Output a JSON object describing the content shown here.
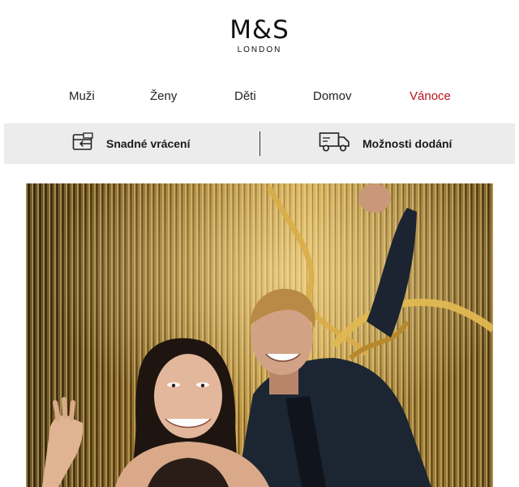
{
  "brand": {
    "name": "M&S",
    "subtitle": "LONDON"
  },
  "nav": {
    "items": [
      {
        "label": "Muži"
      },
      {
        "label": "Ženy"
      },
      {
        "label": "Děti"
      },
      {
        "label": "Domov"
      },
      {
        "label": "Vánoce"
      }
    ],
    "accent_color": "#b5121b"
  },
  "benefits": {
    "returns_label": "Snadné vrácení",
    "returns_icon": "returns-box-icon",
    "delivery_label": "Možnosti dodání",
    "delivery_icon": "delivery-truck-icon",
    "background": "#ececec"
  },
  "hero": {
    "image": "christmas-party-photo",
    "palette": [
      "#c89a3a",
      "#7a5a1e",
      "#2a1f14",
      "#e8c879"
    ]
  }
}
